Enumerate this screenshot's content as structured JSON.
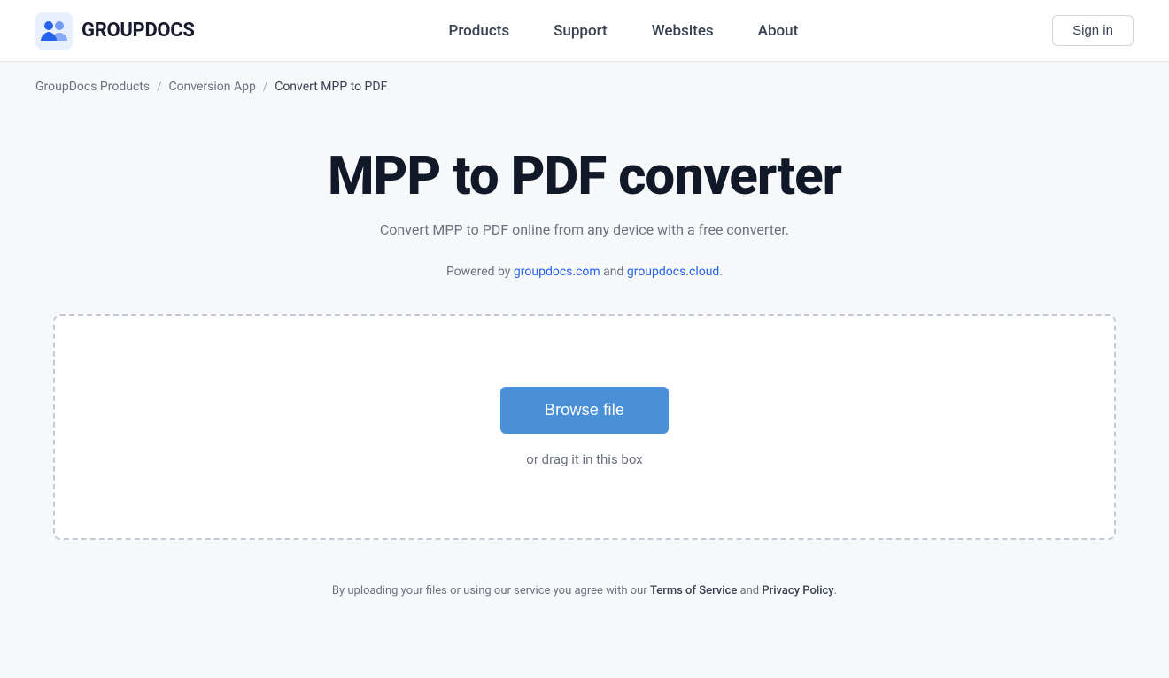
{
  "header": {
    "logo_text": "GROUPDOCS",
    "nav": {
      "items": [
        "Products",
        "Support",
        "Websites",
        "About"
      ]
    },
    "sign_in_label": "Sign in"
  },
  "breadcrumb": {
    "items": [
      {
        "label": "GroupDocs Products",
        "href": "#"
      },
      {
        "label": "Conversion App",
        "href": "#"
      },
      {
        "label": "Convert MPP to PDF",
        "href": "#"
      }
    ]
  },
  "main": {
    "page_title": "MPP to PDF converter",
    "subtitle": "Convert MPP to PDF online from any device with a free converter.",
    "powered_by_prefix": "Powered by ",
    "powered_by_link1_text": "groupdocs.com",
    "powered_by_middle": " and ",
    "powered_by_link2_text": "groupdocs.cloud",
    "powered_by_suffix": ".",
    "browse_button_label": "Browse file",
    "drag_text": "or drag it in this box"
  },
  "footer": {
    "text_prefix": "By uploading your files or using our service you agree with our ",
    "terms_label": "Terms of Service",
    "text_middle": " and ",
    "privacy_label": "Privacy Policy",
    "text_suffix": "."
  }
}
